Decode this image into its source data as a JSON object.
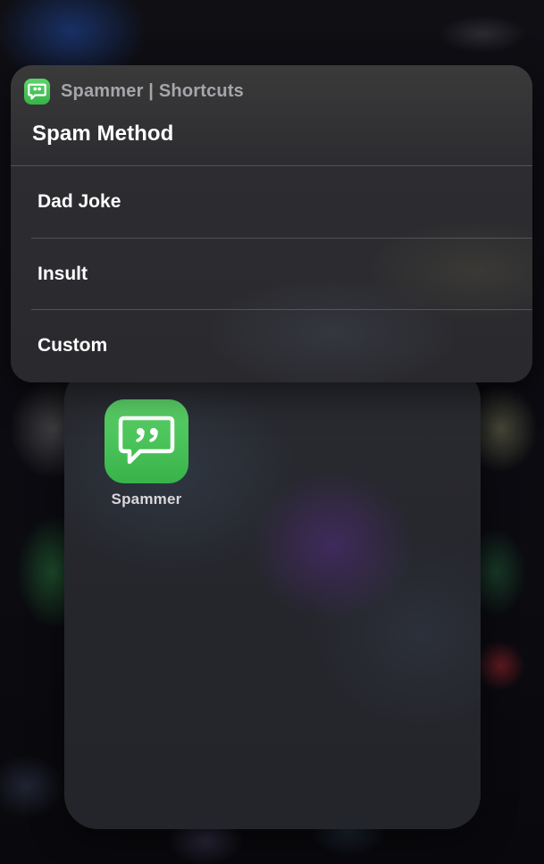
{
  "menu": {
    "app_name": "Spammer | Shortcuts",
    "title": "Spam Method",
    "items": [
      {
        "label": "Dad Joke"
      },
      {
        "label": "Insult"
      },
      {
        "label": "Custom"
      }
    ],
    "header_icon": "quote-bubble-icon"
  },
  "folder": {
    "apps": [
      {
        "label": "Spammer",
        "icon": "quote-bubble-icon"
      }
    ]
  },
  "colors": {
    "app_green": "#4cc45c",
    "menu_bg": "#2c2c30",
    "text_primary": "#ffffff",
    "text_secondary": "#a6a6aa"
  }
}
